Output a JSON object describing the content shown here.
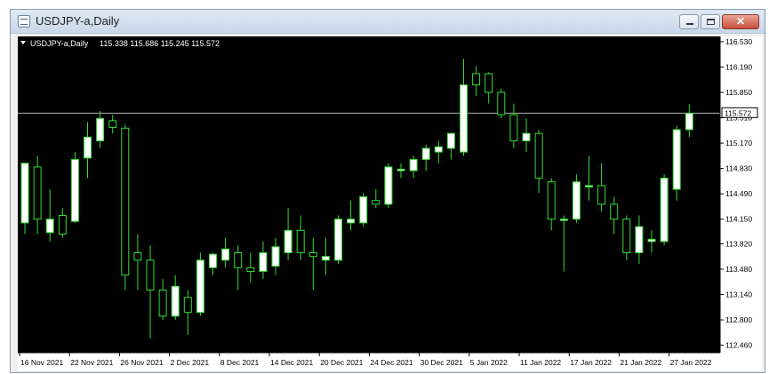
{
  "window": {
    "title": "USDJPY-a,Daily",
    "close_label": "✕"
  },
  "chart_data": {
    "type": "candlestick",
    "symbol_label": "USDJPY-a,Daily",
    "ohlc_label": "115.338 115.686 115.245 115.572",
    "current_price": 115.572,
    "current_price_label": "115.572",
    "ylim": [
      112.36,
      116.6
    ],
    "y_ticks": [
      "116.530",
      "116.190",
      "115.850",
      "115.510",
      "115.170",
      "114.830",
      "114.490",
      "114.150",
      "113.820",
      "113.480",
      "113.140",
      "112.800",
      "112.460"
    ],
    "x_ticks": [
      "16 Nov 2021",
      "22 Nov 2021",
      "26 Nov 2021",
      "2 Dec 2021",
      "8 Dec 2021",
      "14 Dec 2021",
      "20 Dec 2021",
      "24 Dec 2021",
      "30 Dec 2021",
      "5 Jan 2022",
      "11 Jan 2022",
      "17 Jan 2022",
      "21 Jan 2022",
      "27 Jan 2022"
    ],
    "grid": false,
    "colors": {
      "background": "#000000",
      "bull_body": "#ffffff",
      "bear_body": "#000000",
      "wick": "#33dd33",
      "price_line": "#b0b0b0",
      "axis_text": "#000000"
    },
    "candles": [
      {
        "o": 114.1,
        "h": 114.9,
        "l": 113.95,
        "c": 114.9
      },
      {
        "o": 114.85,
        "h": 115.0,
        "l": 113.95,
        "c": 114.15
      },
      {
        "o": 113.97,
        "h": 114.55,
        "l": 113.85,
        "c": 114.15
      },
      {
        "o": 114.2,
        "h": 114.3,
        "l": 113.9,
        "c": 113.95
      },
      {
        "o": 114.12,
        "h": 115.05,
        "l": 114.1,
        "c": 114.95
      },
      {
        "o": 114.97,
        "h": 115.45,
        "l": 114.7,
        "c": 115.25
      },
      {
        "o": 115.2,
        "h": 115.6,
        "l": 115.1,
        "c": 115.5
      },
      {
        "o": 115.47,
        "h": 115.55,
        "l": 115.3,
        "c": 115.38
      },
      {
        "o": 115.37,
        "h": 115.42,
        "l": 113.2,
        "c": 113.4
      },
      {
        "o": 113.7,
        "h": 113.95,
        "l": 113.2,
        "c": 113.6
      },
      {
        "o": 113.6,
        "h": 113.8,
        "l": 112.55,
        "c": 113.2
      },
      {
        "o": 113.2,
        "h": 113.35,
        "l": 112.8,
        "c": 112.85
      },
      {
        "o": 112.85,
        "h": 113.4,
        "l": 112.8,
        "c": 113.25
      },
      {
        "o": 113.1,
        "h": 113.2,
        "l": 112.6,
        "c": 112.9
      },
      {
        "o": 112.9,
        "h": 113.7,
        "l": 112.85,
        "c": 113.6
      },
      {
        "o": 113.5,
        "h": 113.7,
        "l": 113.4,
        "c": 113.68
      },
      {
        "o": 113.6,
        "h": 113.9,
        "l": 113.5,
        "c": 113.75
      },
      {
        "o": 113.7,
        "h": 113.8,
        "l": 113.2,
        "c": 113.5
      },
      {
        "o": 113.5,
        "h": 113.7,
        "l": 113.3,
        "c": 113.45
      },
      {
        "o": 113.45,
        "h": 113.85,
        "l": 113.35,
        "c": 113.7
      },
      {
        "o": 113.52,
        "h": 113.9,
        "l": 113.4,
        "c": 113.78
      },
      {
        "o": 113.7,
        "h": 114.3,
        "l": 113.6,
        "c": 114.0
      },
      {
        "o": 114.0,
        "h": 114.2,
        "l": 113.6,
        "c": 113.7
      },
      {
        "o": 113.7,
        "h": 113.9,
        "l": 113.2,
        "c": 113.65
      },
      {
        "o": 113.6,
        "h": 113.9,
        "l": 113.4,
        "c": 113.65
      },
      {
        "o": 113.6,
        "h": 114.2,
        "l": 113.55,
        "c": 114.15
      },
      {
        "o": 114.1,
        "h": 114.4,
        "l": 114.0,
        "c": 114.15
      },
      {
        "o": 114.1,
        "h": 114.5,
        "l": 114.05,
        "c": 114.45
      },
      {
        "o": 114.4,
        "h": 114.55,
        "l": 114.3,
        "c": 114.35
      },
      {
        "o": 114.35,
        "h": 114.9,
        "l": 114.3,
        "c": 114.85
      },
      {
        "o": 114.8,
        "h": 114.9,
        "l": 114.7,
        "c": 114.82
      },
      {
        "o": 114.8,
        "h": 115.0,
        "l": 114.7,
        "c": 114.95
      },
      {
        "o": 114.95,
        "h": 115.15,
        "l": 114.8,
        "c": 115.1
      },
      {
        "o": 115.05,
        "h": 115.2,
        "l": 114.9,
        "c": 115.12
      },
      {
        "o": 115.1,
        "h": 115.3,
        "l": 114.95,
        "c": 115.3
      },
      {
        "o": 115.05,
        "h": 116.3,
        "l": 115.0,
        "c": 115.95
      },
      {
        "o": 116.1,
        "h": 116.2,
        "l": 115.8,
        "c": 115.95
      },
      {
        "o": 116.1,
        "h": 116.12,
        "l": 115.7,
        "c": 115.85
      },
      {
        "o": 115.85,
        "h": 115.9,
        "l": 115.5,
        "c": 115.55
      },
      {
        "o": 115.55,
        "h": 115.7,
        "l": 115.1,
        "c": 115.2
      },
      {
        "o": 115.2,
        "h": 115.5,
        "l": 115.05,
        "c": 115.3
      },
      {
        "o": 115.3,
        "h": 115.35,
        "l": 114.5,
        "c": 114.7
      },
      {
        "o": 114.65,
        "h": 114.7,
        "l": 114.0,
        "c": 114.15
      },
      {
        "o": 114.15,
        "h": 114.2,
        "l": 113.45,
        "c": 114.15
      },
      {
        "o": 114.15,
        "h": 114.75,
        "l": 114.1,
        "c": 114.65
      },
      {
        "o": 114.6,
        "h": 115.0,
        "l": 114.4,
        "c": 114.6
      },
      {
        "o": 114.6,
        "h": 114.9,
        "l": 114.25,
        "c": 114.35
      },
      {
        "o": 114.35,
        "h": 114.45,
        "l": 113.95,
        "c": 114.15
      },
      {
        "o": 114.15,
        "h": 114.2,
        "l": 113.6,
        "c": 113.7
      },
      {
        "o": 113.7,
        "h": 114.2,
        "l": 113.55,
        "c": 114.05
      },
      {
        "o": 113.85,
        "h": 114.0,
        "l": 113.7,
        "c": 113.88
      },
      {
        "o": 113.85,
        "h": 114.75,
        "l": 113.8,
        "c": 114.7
      },
      {
        "o": 114.55,
        "h": 115.4,
        "l": 114.4,
        "c": 115.35
      },
      {
        "o": 115.35,
        "h": 115.69,
        "l": 115.25,
        "c": 115.57
      }
    ]
  }
}
